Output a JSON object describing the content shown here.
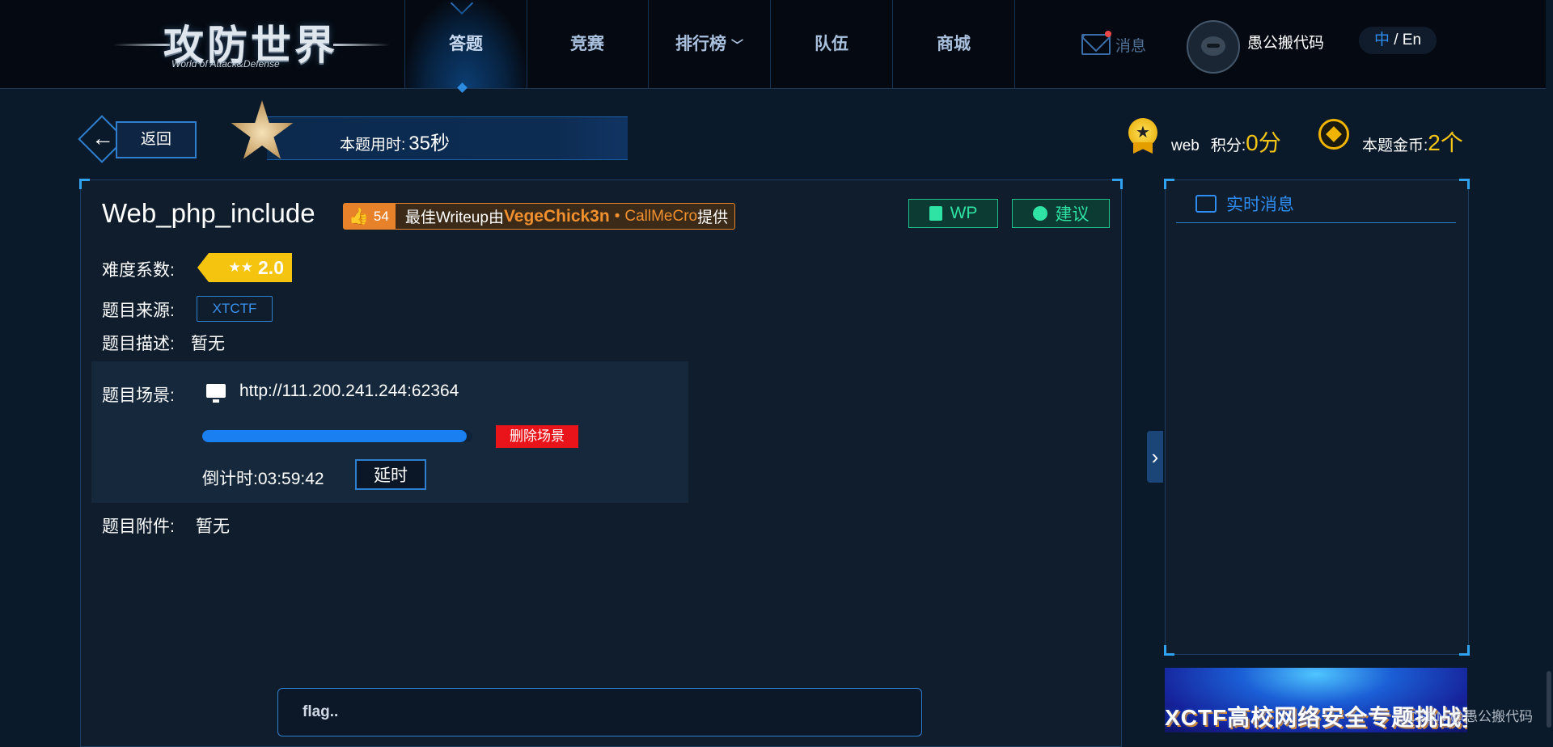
{
  "nav": {
    "logo_main": "攻防世界",
    "logo_sub": "World of Attack&Defense",
    "items": [
      {
        "label": "答题"
      },
      {
        "label": "竞赛"
      },
      {
        "label": "排行榜"
      },
      {
        "label": "队伍"
      },
      {
        "label": "商城"
      }
    ],
    "active_index": 0,
    "messages_label": "消息",
    "username": "愚公搬代码",
    "lang_zh": "中",
    "lang_sep": " / ",
    "lang_en": "En"
  },
  "header": {
    "back_label": "返回",
    "time_label": "本题用时:",
    "time_value": "35秒",
    "category": "web",
    "score_label": "积分:",
    "score_value": "0分",
    "coins_label": "本题金币:",
    "coins_value": "2个"
  },
  "challenge": {
    "title": "Web_php_include",
    "likes": "54",
    "writeup_prefix": "最佳Writeup由",
    "writeup_author": "VegeChick3n",
    "writeup_sep": "•",
    "writeup_author2": "CallMeCro",
    "writeup_suffix": "提供",
    "wp_label": "WP",
    "suggest_label": "建议",
    "difficulty_label": "难度系数:",
    "difficulty_stars": "★★",
    "difficulty_value": "2.0",
    "source_label": "题目来源:",
    "source_value": "XTCTF",
    "description_label": "题目描述:",
    "description_value": "暂无",
    "scene_label": "题目场景:",
    "scene_url": "http://111.200.241.244:62364",
    "scene_progress": 0.98,
    "delete_label": "删除场景",
    "countdown_label": "倒计时:",
    "countdown_value": "03:59:42",
    "extend_label": "延时",
    "attachment_label": "题目附件:",
    "attachment_value": "暂无",
    "flag_placeholder": "flag.."
  },
  "sidebar": {
    "news_title": "实时消息",
    "banner_text": "XCTF高校网络安全专题挑战赛"
  },
  "watermark": "CSDN @愚公搬代码",
  "colors": {
    "accent_blue": "#2f8cf0",
    "gold": "#f5c518",
    "writeup_orange": "#e8822a",
    "green_btn": "#2ee3a3",
    "danger_red": "#e8141a"
  }
}
